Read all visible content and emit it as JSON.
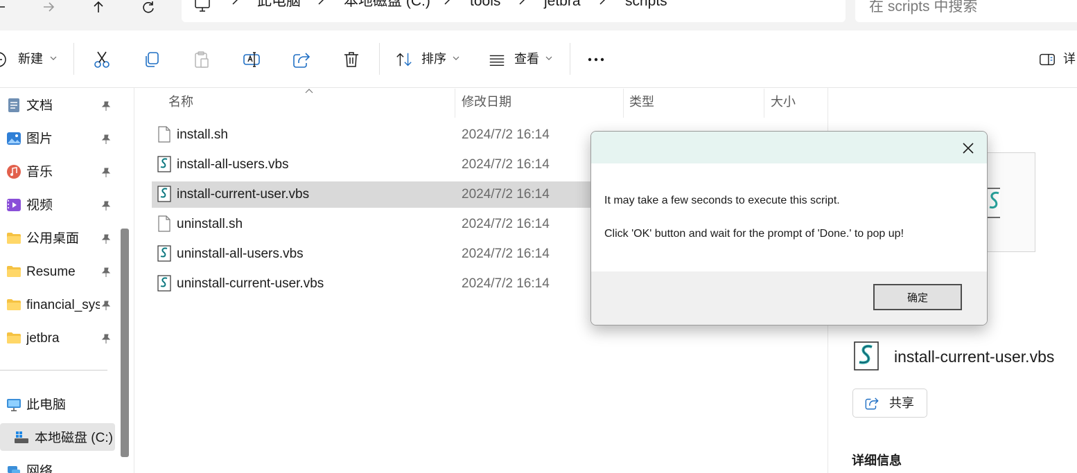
{
  "address_bar": {
    "crumbs": [
      "此电脑",
      "本地磁盘 (C:)",
      "tools",
      "jetbra",
      "scripts"
    ],
    "search_placeholder": "在 scripts 中搜索"
  },
  "toolbar": {
    "new_label": "新建",
    "sort_label": "排序",
    "view_label": "查看",
    "details_label": "详"
  },
  "nav": {
    "quick_access": [
      {
        "label": "文档",
        "icon": "documents-icon"
      },
      {
        "label": "图片",
        "icon": "pictures-icon"
      },
      {
        "label": "音乐",
        "icon": "music-icon"
      },
      {
        "label": "视频",
        "icon": "videos-icon"
      },
      {
        "label": "公用桌面",
        "icon": "folder-icon"
      },
      {
        "label": "Resume",
        "icon": "folder-icon"
      },
      {
        "label": "financial_sys",
        "icon": "folder-icon"
      },
      {
        "label": "jetbra",
        "icon": "folder-icon"
      }
    ],
    "this_pc": "此电脑",
    "local_disk": "本地磁盘 (C:)",
    "network": "网络"
  },
  "file_list": {
    "columns": {
      "name": "名称",
      "modified": "修改日期",
      "type": "类型",
      "size": "大小"
    },
    "files": [
      {
        "name": "install.sh",
        "modified": "2024/7/2 16:14",
        "icon": "generic-file-icon"
      },
      {
        "name": "install-all-users.vbs",
        "modified": "2024/7/2 16:14",
        "icon": "vbs-script-icon"
      },
      {
        "name": "install-current-user.vbs",
        "modified": "2024/7/2 16:14",
        "icon": "vbs-script-icon",
        "selected": true
      },
      {
        "name": "uninstall.sh",
        "modified": "2024/7/2 16:14",
        "icon": "generic-file-icon"
      },
      {
        "name": "uninstall-all-users.vbs",
        "modified": "2024/7/2 16:14",
        "icon": "vbs-script-icon"
      },
      {
        "name": "uninstall-current-user.vbs",
        "modified": "2024/7/2 16:14",
        "icon": "vbs-script-icon"
      }
    ]
  },
  "details_pane": {
    "filename": "install-current-user.vbs",
    "share_label": "共享",
    "info_heading": "详细信息"
  },
  "dialog": {
    "message_line1": "It may take a few seconds to execute this script.",
    "message_line2": "Click 'OK' button and wait for the prompt of 'Done.' to pop up!",
    "ok_label": "确定"
  },
  "colors": {
    "dialog_titlebar": "#e6f4f1",
    "selection": "#d9d9d9",
    "folder": "#f5c243",
    "accent_blue": "#1f6fc4"
  }
}
